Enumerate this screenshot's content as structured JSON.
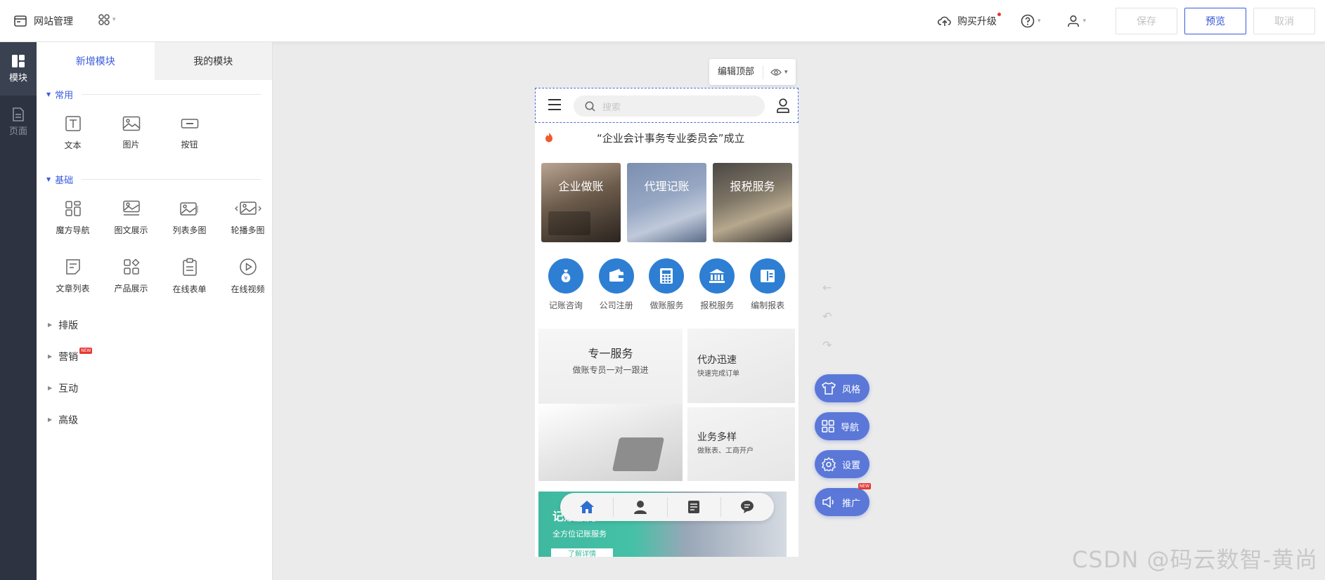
{
  "header": {
    "title": "网站管理",
    "upgrade_label": "购买升级",
    "save_label": "保存",
    "preview_label": "预览",
    "cancel_label": "取消"
  },
  "rail": {
    "items": [
      {
        "label": "模块",
        "icon": "module-icon",
        "active": true
      },
      {
        "label": "页面",
        "icon": "page-icon",
        "active": false
      }
    ]
  },
  "panel": {
    "tabs": [
      {
        "label": "新增模块",
        "active": true
      },
      {
        "label": "我的模块",
        "active": false
      }
    ],
    "sections": [
      {
        "title": "常用",
        "items": [
          {
            "label": "文本",
            "icon": "text-icon"
          },
          {
            "label": "图片",
            "icon": "image-icon"
          },
          {
            "label": "按钮",
            "icon": "button-icon"
          }
        ]
      },
      {
        "title": "基础",
        "items": [
          {
            "label": "魔方导航",
            "icon": "cube-nav-icon"
          },
          {
            "label": "图文展示",
            "icon": "image-text-icon"
          },
          {
            "label": "列表多图",
            "icon": "list-images-icon"
          },
          {
            "label": "轮播多图",
            "icon": "carousel-icon"
          },
          {
            "label": "文章列表",
            "icon": "article-list-icon"
          },
          {
            "label": "产品展示",
            "icon": "product-icon"
          },
          {
            "label": "在线表单",
            "icon": "form-icon"
          },
          {
            "label": "在线视频",
            "icon": "video-icon"
          }
        ]
      }
    ],
    "collapsed": [
      {
        "label": "排版"
      },
      {
        "label": "营销",
        "badge": "NEW"
      },
      {
        "label": "互动"
      },
      {
        "label": "高级"
      }
    ]
  },
  "editor": {
    "edit_header_label": "编辑顶部"
  },
  "phone": {
    "search_placeholder": "搜索",
    "notice": "“企业会计事务专业委员会”成立",
    "cards": [
      {
        "label": "企业做账"
      },
      {
        "label": "代理记账"
      },
      {
        "label": "报税服务"
      }
    ],
    "services": [
      {
        "label": "记账咨询",
        "icon": "money-bag-icon"
      },
      {
        "label": "公司注册",
        "icon": "wallet-icon"
      },
      {
        "label": "做账服务",
        "icon": "calculator-icon"
      },
      {
        "label": "报税服务",
        "icon": "bank-icon"
      },
      {
        "label": "编制报表",
        "icon": "report-icon"
      }
    ],
    "promo_main": {
      "title": "专一服务",
      "subtitle": "做账专员一对一跟进"
    },
    "promo_top": {
      "title": "代办迅速",
      "subtitle": "快速完成订单"
    },
    "promo_bottom": {
      "title": "业务多样",
      "subtitle": "做账表、工商开户"
    },
    "banner": {
      "title": "记账服务",
      "subtitle": "全方位记账服务",
      "button": "了解详情"
    },
    "tabbar": [
      "home-icon",
      "user-icon",
      "document-icon",
      "chat-icon"
    ]
  },
  "fabs": [
    {
      "label": "风格",
      "icon": "shirt-icon"
    },
    {
      "label": "导航",
      "icon": "grid-icon"
    },
    {
      "label": "设置",
      "icon": "gear-icon"
    },
    {
      "label": "推广",
      "icon": "megaphone-icon",
      "badge": "NEW"
    }
  ],
  "watermark": "CSDN @码云数智-黄尚",
  "colors": {
    "accent": "#3a5ce0",
    "service_blue": "#2e7fd3",
    "fab": "#5b78d8",
    "rail": "#2d3340"
  }
}
